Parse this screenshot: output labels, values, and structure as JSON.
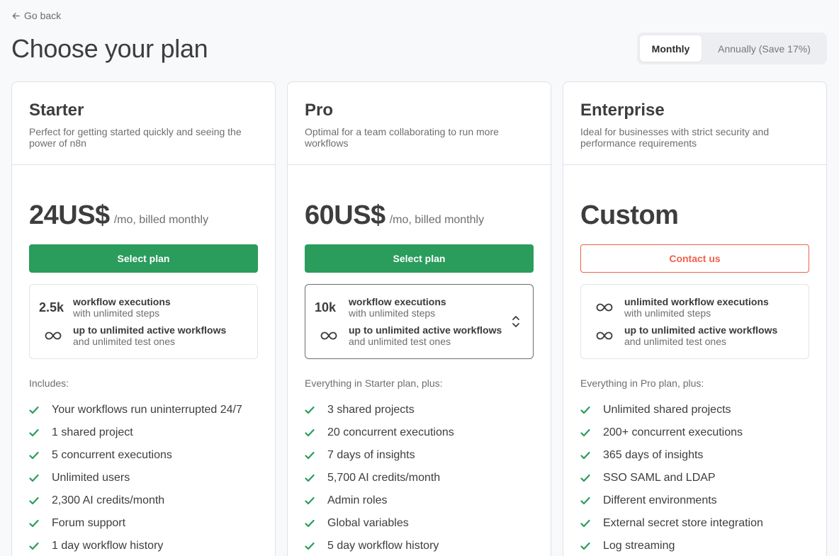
{
  "nav": {
    "back_label": "Go back"
  },
  "page": {
    "title": "Choose your plan"
  },
  "billing_toggle": {
    "monthly": "Monthly",
    "annually": "Annually (Save 17%)",
    "selected": "Monthly"
  },
  "colors": {
    "primary_green": "#2a9c5c",
    "accent_red": "#f0604b"
  },
  "plans": [
    {
      "name": "Starter",
      "description": "Perfect for getting started quickly and seeing the power of n8n",
      "price": "24US$",
      "price_suffix": "/mo, billed monthly",
      "cta": "Select plan",
      "quota": {
        "executions_value": "2.5k",
        "executions_label": "workflow executions",
        "executions_sub": "with unlimited steps",
        "workflows_icon": "infinity-icon",
        "workflows_label": "up to unlimited active workflows",
        "workflows_sub": "and unlimited test ones"
      },
      "includes_heading": "Includes:",
      "features": [
        "Your workflows run uninterrupted 24/7",
        "1 shared project",
        "5 concurrent executions",
        "Unlimited users",
        "2,300 AI credits/month",
        "Forum support",
        "1 day workflow history"
      ]
    },
    {
      "name": "Pro",
      "description": "Optimal for a team collaborating to run more workflows",
      "price": "60US$",
      "price_suffix": "/mo, billed monthly",
      "cta": "Select plan",
      "quota": {
        "executions_value": "10k",
        "executions_label": "workflow executions",
        "executions_sub": "with unlimited steps",
        "workflows_icon": "infinity-icon",
        "workflows_label": "up to unlimited active workflows",
        "workflows_sub": "and unlimited test ones"
      },
      "includes_heading": "Everything in Starter plan, plus:",
      "features": [
        "3 shared projects",
        "20 concurrent executions",
        "7 days of insights",
        "5,700 AI credits/month",
        "Admin roles",
        "Global variables",
        "5 day workflow history"
      ]
    },
    {
      "name": "Enterprise",
      "description": "Ideal for businesses with strict security and performance requirements",
      "price": "Custom",
      "price_suffix": "",
      "cta": "Contact us",
      "quota": {
        "executions_icon": "infinity-icon",
        "executions_label": "unlimited workflow executions",
        "executions_sub": "with unlimited steps",
        "workflows_icon": "infinity-icon",
        "workflows_label": "up to unlimited active workflows",
        "workflows_sub": "and unlimited test ones"
      },
      "includes_heading": "Everything in Pro plan, plus:",
      "features": [
        "Unlimited shared projects",
        "200+ concurrent executions",
        "365 days of insights",
        "SSO SAML and LDAP",
        "Different environments",
        "External secret store integration",
        "Log streaming"
      ]
    }
  ]
}
